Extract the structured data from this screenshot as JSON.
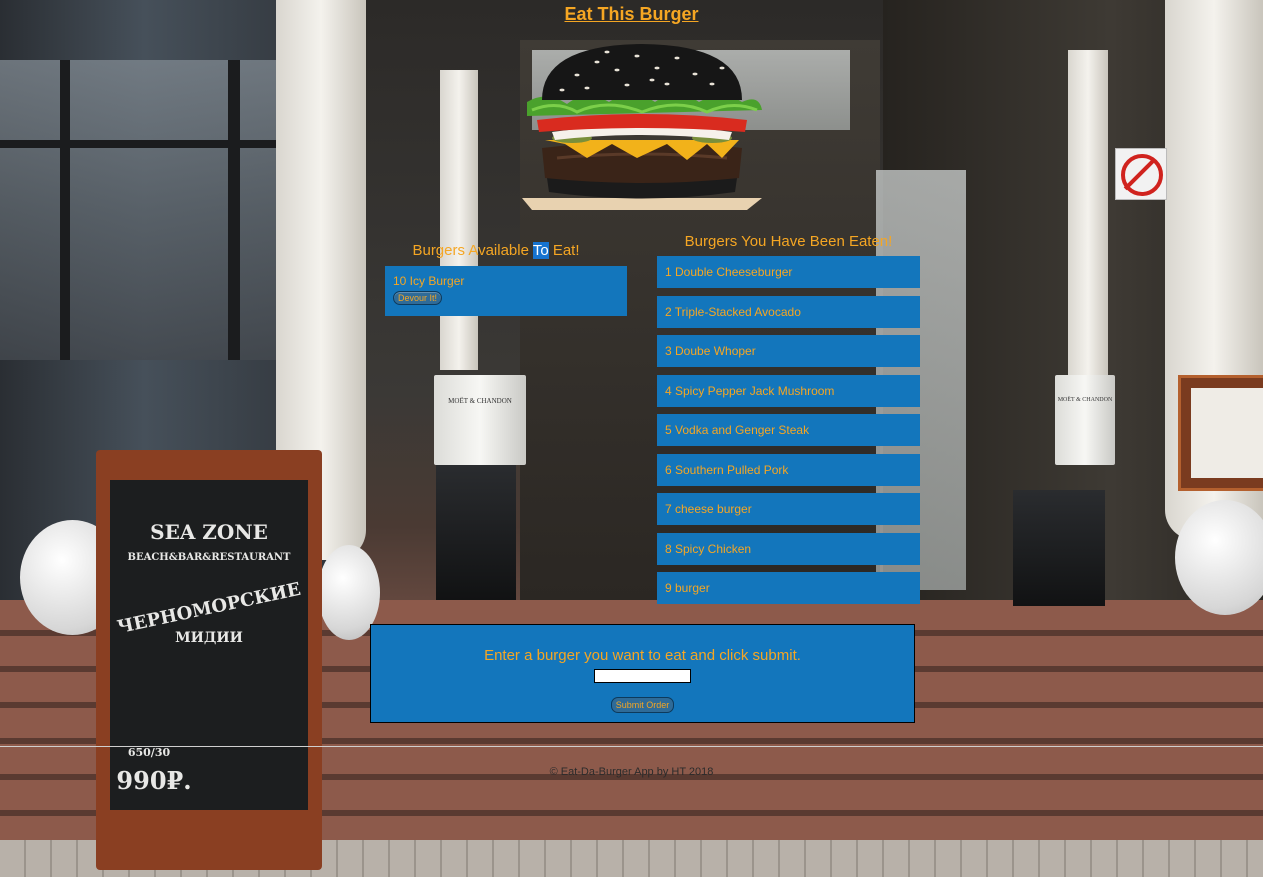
{
  "header": {
    "title": "Eat This Burger"
  },
  "hero": {
    "image_name": "black-bun-burger"
  },
  "available": {
    "heading_before": "Burgers Available ",
    "heading_highlight": "To",
    "heading_after": " Eat!",
    "items": [
      {
        "label": "10 Icy Burger",
        "button_label": "Devour It!"
      }
    ]
  },
  "eaten": {
    "heading": "Burgers You Have Been Eaten!",
    "items": [
      {
        "label": "1 Double Cheeseburger"
      },
      {
        "label": "2 Triple-Stacked Avocado"
      },
      {
        "label": "3 Doube Whoper"
      },
      {
        "label": "4 Spicy Pepper Jack Mushroom"
      },
      {
        "label": "5 Vodka and Genger Steak"
      },
      {
        "label": "6 Southern Pulled Pork"
      },
      {
        "label": "7 cheese burger"
      },
      {
        "label": "8 Spicy Chicken"
      },
      {
        "label": "9 burger"
      }
    ]
  },
  "order_form": {
    "prompt": "Enter a burger you want to eat and click submit.",
    "input_value": "",
    "submit_label": "Submit Order"
  },
  "footer": {
    "text": "© Eat-Da-Burger App by HT 2018"
  },
  "background": {
    "chalkboard_lines": [
      "SEA ZONE",
      "BEACH&BAR&RESTAURANT",
      "ЧЕРНОМОРСКИЕ",
      "МИДИИ",
      "650/30",
      "990₽."
    ],
    "bucket_label_left": "MOËT & CHANDON",
    "bucket_label_right": "MOËT & CHANDON"
  },
  "colors": {
    "accent_text": "#f5a623",
    "card_blue": "#1376bc",
    "highlight_blue": "#1673cf"
  }
}
